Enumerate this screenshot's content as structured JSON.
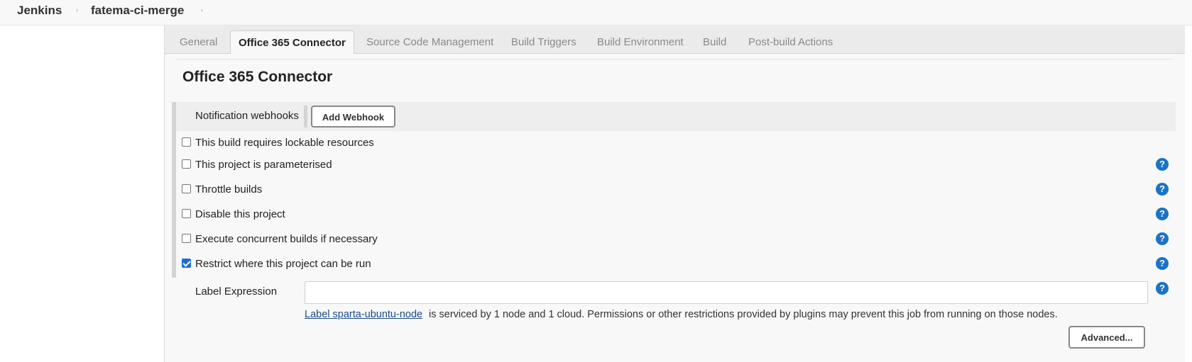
{
  "breadcrumb": {
    "home": "Jenkins",
    "job": "fatema-ci-merge",
    "separator": "›"
  },
  "tabs": [
    {
      "label": "General"
    },
    {
      "label": "Office 365 Connector",
      "active": true
    },
    {
      "label": "Source Code Management"
    },
    {
      "label": "Build Triggers"
    },
    {
      "label": "Build Environment"
    },
    {
      "label": "Build"
    },
    {
      "label": "Post-build Actions"
    }
  ],
  "section": {
    "title": "Office 365 Connector",
    "webhooks_label": "Notification webhooks",
    "add_webhook": "Add Webhook"
  },
  "options": [
    {
      "label": "This build requires lockable resources",
      "checked": false,
      "help": false
    },
    {
      "label": "This project is parameterised",
      "checked": false,
      "help": true
    },
    {
      "label": "Throttle builds",
      "checked": false,
      "help": true
    },
    {
      "label": "Disable this project",
      "checked": false,
      "help": true
    },
    {
      "label": "Execute concurrent builds if necessary",
      "checked": false,
      "help": true
    },
    {
      "label": "Restrict where this project can be run",
      "checked": true,
      "help": true
    }
  ],
  "label_expression": {
    "label": "Label Expression",
    "value": "",
    "link_text": "Label sparta-ubuntu-node",
    "info_text": "is serviced by 1 node and 1 cloud. Permissions or other restrictions provided by plugins may prevent this job from running on those nodes.",
    "help_symbol": "?"
  },
  "advanced_button": "Advanced...",
  "colors": {
    "accent": "#1a73c6",
    "link": "#1a4d8c",
    "checkbox_checked": "#1a6ed8"
  },
  "icons": {
    "help": "help-circle-icon",
    "separator": "chevron-right-icon",
    "checkbox": "checkbox-icon"
  }
}
